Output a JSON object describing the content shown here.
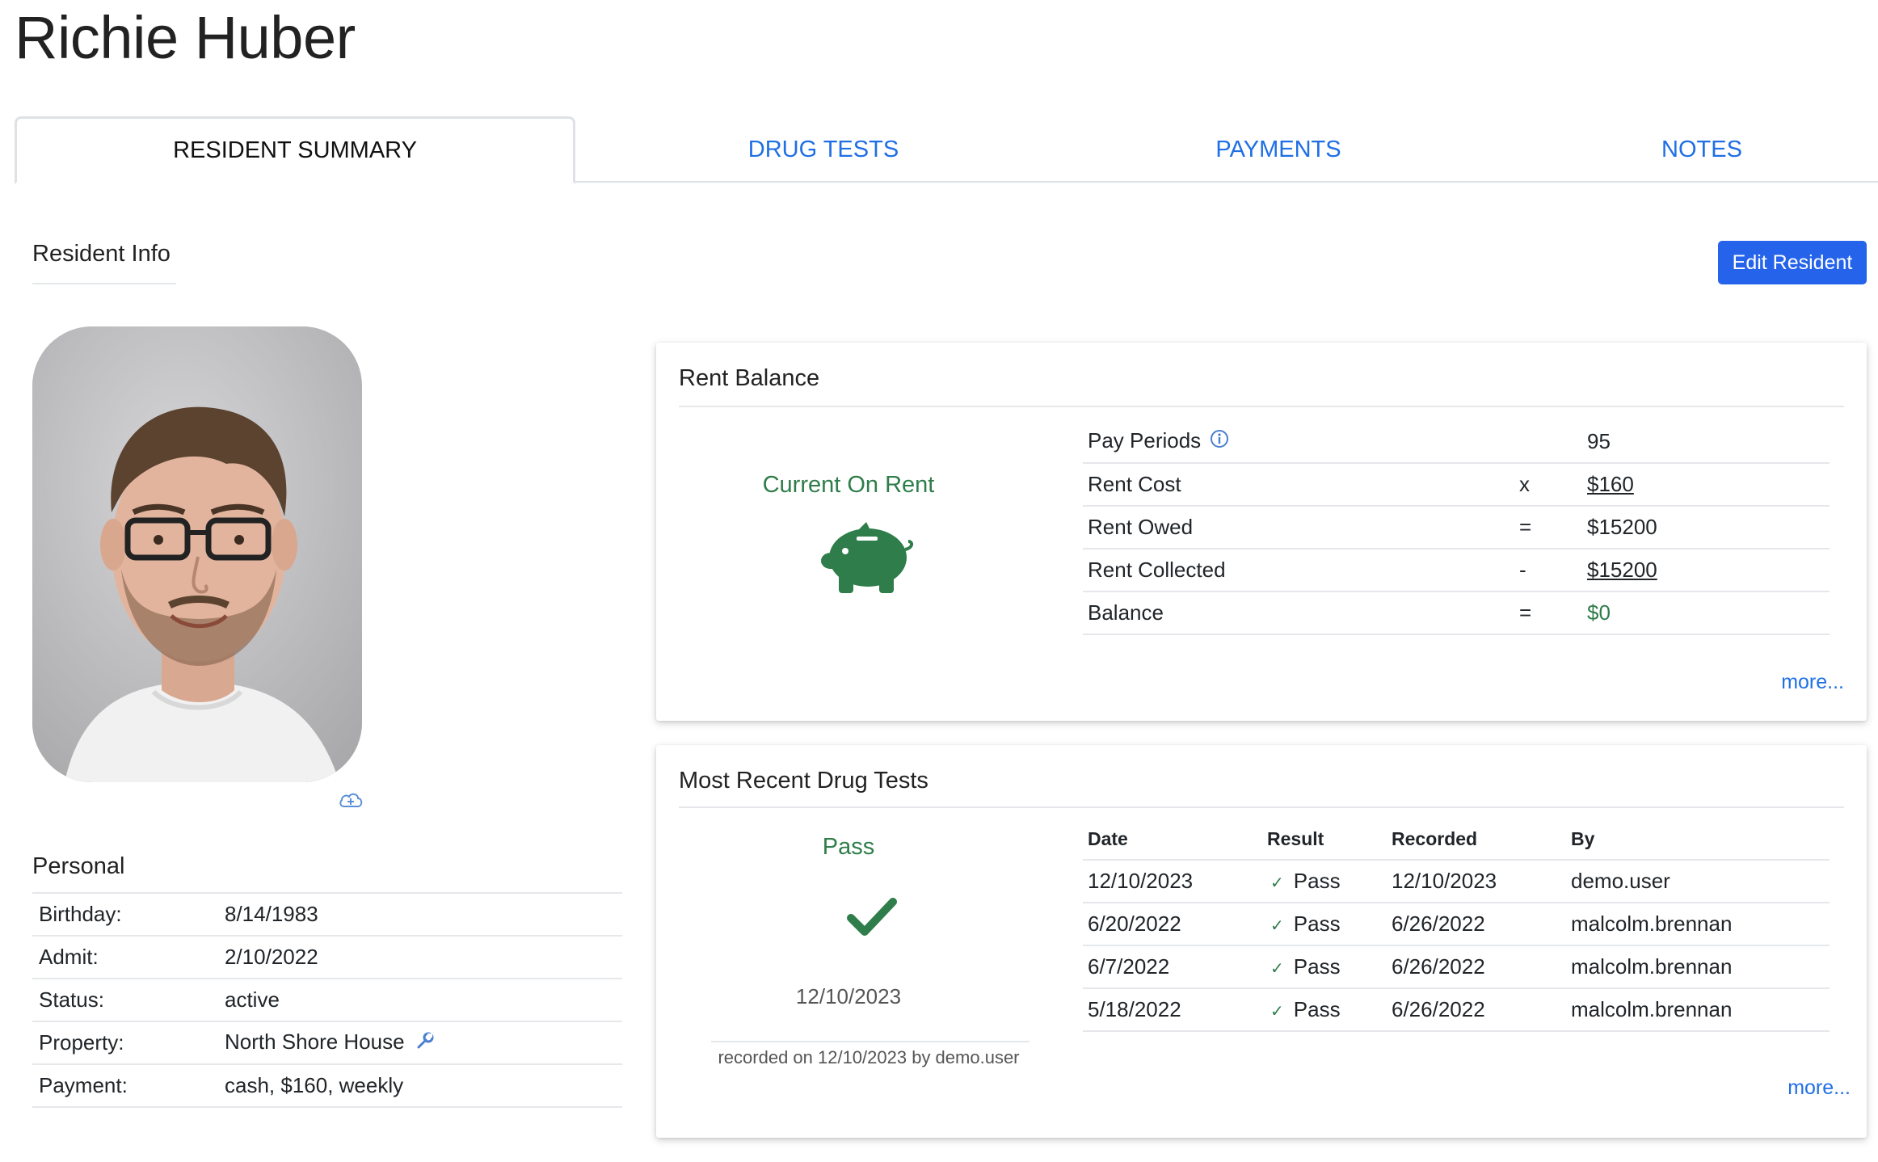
{
  "header": {
    "title": "Richie Huber"
  },
  "tabs": [
    {
      "label": "RESIDENT SUMMARY",
      "active": true
    },
    {
      "label": "DRUG TESTS"
    },
    {
      "label": "PAYMENTS"
    },
    {
      "label": "NOTES"
    }
  ],
  "resident_info": {
    "heading": "Resident Info",
    "edit_button": "Edit Resident",
    "upload_icon": "cloud-upload-icon"
  },
  "personal": {
    "heading": "Personal",
    "rows": [
      {
        "key": "Birthday:",
        "value": "8/14/1983"
      },
      {
        "key": "Admit:",
        "value": "2/10/2022"
      },
      {
        "key": "Status:",
        "value": "active"
      },
      {
        "key": "Property:",
        "value": "North Shore House"
      },
      {
        "key": "Payment:",
        "value": "cash, $160, weekly"
      }
    ]
  },
  "rent_balance": {
    "title": "Rent Balance",
    "status": "Current On Rent",
    "status_color": "#2f7d4a",
    "rows": [
      {
        "label": "Pay Periods",
        "op": "",
        "value": "95"
      },
      {
        "label": "Rent Cost",
        "op": "x",
        "value": "$160"
      },
      {
        "label": "Rent Owed",
        "op": "=",
        "value": "$15200"
      },
      {
        "label": "Rent Collected",
        "op": "-",
        "value": "$15200"
      },
      {
        "label": "Balance",
        "op": "=",
        "value": "$0"
      }
    ],
    "more": "more..."
  },
  "drug_tests": {
    "title": "Most Recent Drug Tests",
    "latest_result": "Pass",
    "latest_date": "12/10/2023",
    "recorded_note": "recorded on 12/10/2023 by demo.user",
    "columns": [
      "Date",
      "Result",
      "Recorded",
      "By"
    ],
    "rows": [
      {
        "date": "12/10/2023",
        "result": "Pass",
        "recorded": "12/10/2023",
        "by": "demo.user"
      },
      {
        "date": "6/20/2022",
        "result": "Pass",
        "recorded": "6/26/2022",
        "by": "malcolm.brennan"
      },
      {
        "date": "6/7/2022",
        "result": "Pass",
        "recorded": "6/26/2022",
        "by": "malcolm.brennan"
      },
      {
        "date": "5/18/2022",
        "result": "Pass",
        "recorded": "6/26/2022",
        "by": "malcolm.brennan"
      }
    ],
    "more": "more..."
  },
  "colors": {
    "accent": "#2563eb",
    "link": "#1f6fe5",
    "success": "#2f7d4a"
  }
}
